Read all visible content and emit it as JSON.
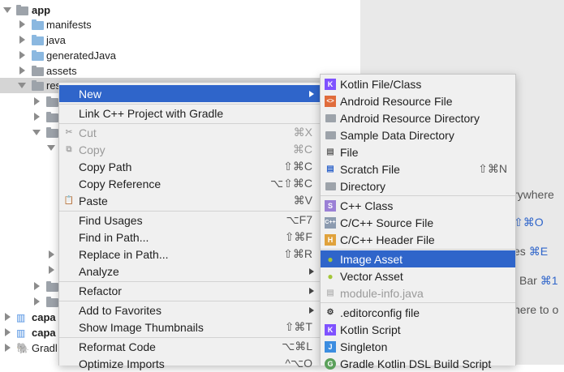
{
  "tree": {
    "items": [
      {
        "label": "app"
      },
      {
        "label": "manifests"
      },
      {
        "label": "java"
      },
      {
        "label": "generatedJava"
      },
      {
        "label": "assets"
      },
      {
        "label": "res"
      },
      {
        "label": "capa"
      },
      {
        "label": "capa"
      },
      {
        "label": "Gradl"
      }
    ]
  },
  "editor_hints": [
    {
      "text": "rywhere",
      "key": ""
    },
    {
      "text": "",
      "key": "⇧⌘O"
    },
    {
      "text": "es ",
      "key": "⌘E"
    },
    {
      "text": "Bar ",
      "key": "⌘1"
    },
    {
      "text": "here to o",
      "key": ""
    }
  ],
  "context_menu": {
    "items": [
      {
        "label": "New",
        "shortcut": ""
      },
      {
        "label": "Link C++ Project with Gradle",
        "shortcut": ""
      },
      {
        "label": "Cut",
        "shortcut": "⌘X"
      },
      {
        "label": "Copy",
        "shortcut": "⌘C"
      },
      {
        "label": "Copy Path",
        "shortcut": "⇧⌘C"
      },
      {
        "label": "Copy Reference",
        "shortcut": "⌥⇧⌘C"
      },
      {
        "label": "Paste",
        "shortcut": "⌘V"
      },
      {
        "label": "Find Usages",
        "shortcut": "⌥F7"
      },
      {
        "label": "Find in Path...",
        "shortcut": "⇧⌘F"
      },
      {
        "label": "Replace in Path...",
        "shortcut": "⇧⌘R"
      },
      {
        "label": "Analyze",
        "shortcut": ""
      },
      {
        "label": "Refactor",
        "shortcut": ""
      },
      {
        "label": "Add to Favorites",
        "shortcut": ""
      },
      {
        "label": "Show Image Thumbnails",
        "shortcut": "⇧⌘T"
      },
      {
        "label": "Reformat Code",
        "shortcut": "⌥⌘L"
      },
      {
        "label": "Optimize Imports",
        "shortcut": "^⌥O"
      }
    ]
  },
  "submenu": {
    "items": [
      {
        "label": "Kotlin File/Class",
        "shortcut": ""
      },
      {
        "label": "Android Resource File",
        "shortcut": ""
      },
      {
        "label": "Android Resource Directory",
        "shortcut": ""
      },
      {
        "label": "Sample Data Directory",
        "shortcut": ""
      },
      {
        "label": "File",
        "shortcut": ""
      },
      {
        "label": "Scratch File",
        "shortcut": "⇧⌘N"
      },
      {
        "label": "Directory",
        "shortcut": ""
      },
      {
        "label": "C++ Class",
        "shortcut": ""
      },
      {
        "label": "C/C++ Source File",
        "shortcut": ""
      },
      {
        "label": "C/C++ Header File",
        "shortcut": ""
      },
      {
        "label": "Image Asset",
        "shortcut": ""
      },
      {
        "label": "Vector Asset",
        "shortcut": ""
      },
      {
        "label": "module-info.java",
        "shortcut": ""
      },
      {
        "label": ".editorconfig file",
        "shortcut": ""
      },
      {
        "label": "Kotlin Script",
        "shortcut": ""
      },
      {
        "label": "Singleton",
        "shortcut": ""
      },
      {
        "label": "Gradle Kotlin DSL Build Script",
        "shortcut": ""
      }
    ]
  },
  "colors": {
    "highlight": "#2f65ca",
    "menu_bg": "#f0f0f0",
    "folder": "#8bb8e0"
  }
}
